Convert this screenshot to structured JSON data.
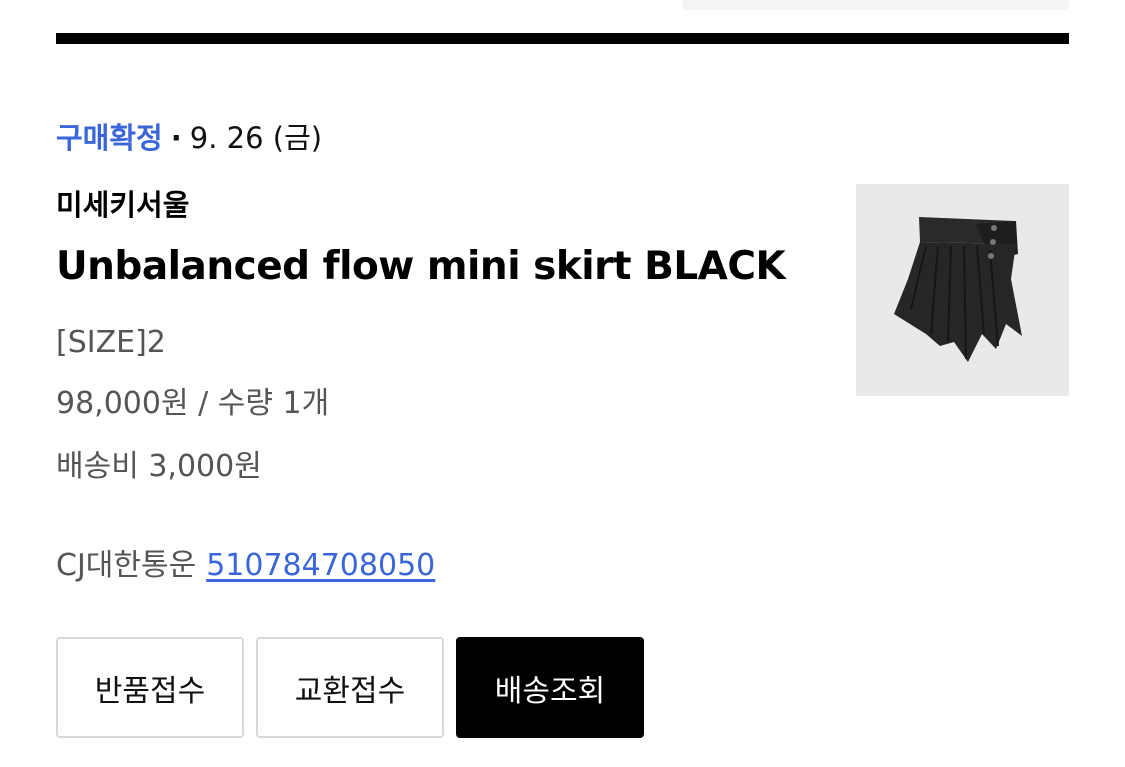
{
  "order": {
    "status_label": "구매확정",
    "separator": "·",
    "date": "9. 26 (금)",
    "brand": "미세키서울",
    "product_name": "Unbalanced flow mini skirt BLACK",
    "option": "[SIZE]2",
    "price_qty": "98,000원 / 수량 1개",
    "shipping_fee": "배송비 3,000원",
    "courier": "CJ대한통운",
    "tracking_number": "510784708050",
    "thumbnail_icon": "skirt-image"
  },
  "actions": {
    "return_label": "반품접수",
    "exchange_label": "교환접수",
    "track_label": "배송조회"
  },
  "colors": {
    "accent_blue": "#3a66d9",
    "primary_button": "#000000",
    "thumbnail_bg": "#e9e9e9"
  }
}
